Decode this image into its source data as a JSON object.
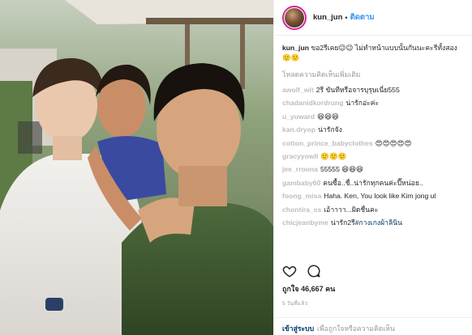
{
  "post": {
    "username": "kun_jun",
    "follow_label": "ติดตาม",
    "caption_user": "kun_jun",
    "caption_text": "ขอ2รีเคย😉😉 ไม่ทำหน้าแบบนั้นกันนะคะรีทั้งสอง🙂🙂",
    "load_more": "โหลดความคิดเห็นเพิ่มเติม",
    "likes": "ถูกใจ 46,667 คน",
    "time_ago": "5 วันที่แล้ว",
    "login_link": "เข้าสู่ระบบ",
    "login_text": "เพื่อถูกใจหรือความคิดเห็น"
  },
  "comments": [
    {
      "user": "awolf_wit",
      "text": "2รี ขันทีหรือจารบุรุษเนี่ย555"
    },
    {
      "user": "chadanidkordrung",
      "text": "น่ารักอ่ะค่ะ"
    },
    {
      "user": "u_yuward",
      "text": "😆😆😆"
    },
    {
      "user": "kan.dryop",
      "text": "น่ารักจัง"
    },
    {
      "user": "cotton_prince_babyclothes",
      "text": "😍😍😍😍😍"
    },
    {
      "user": "gracyyowll",
      "text": "🙂🙂🙂"
    },
    {
      "user": "jee_rroona",
      "text": "55555 😆😆😆"
    },
    {
      "user": "gambaby60",
      "text": "คนซื้อ..ชื่..น่ารักทุกคนค่ะปี๊หน่อย.."
    },
    {
      "user": "foong_misa",
      "text": "Haha. Ken, You look like Kim jong ul"
    },
    {
      "user": "chontira_ss",
      "text": "เอ้าาาา...ผิดชื่นคะ"
    },
    {
      "user": "chicjeanbyme",
      "text": "น่ารัก2รี",
      "tag": "#กางเกงผ้าลินิน"
    }
  ],
  "icons": {
    "like": "heart-outline-icon",
    "comment": "comment-bubble-icon"
  },
  "colors": {
    "link_blue": "#3897f0",
    "dark_link": "#003569",
    "muted": "#999999",
    "avatar_ring": "#d6249f"
  }
}
